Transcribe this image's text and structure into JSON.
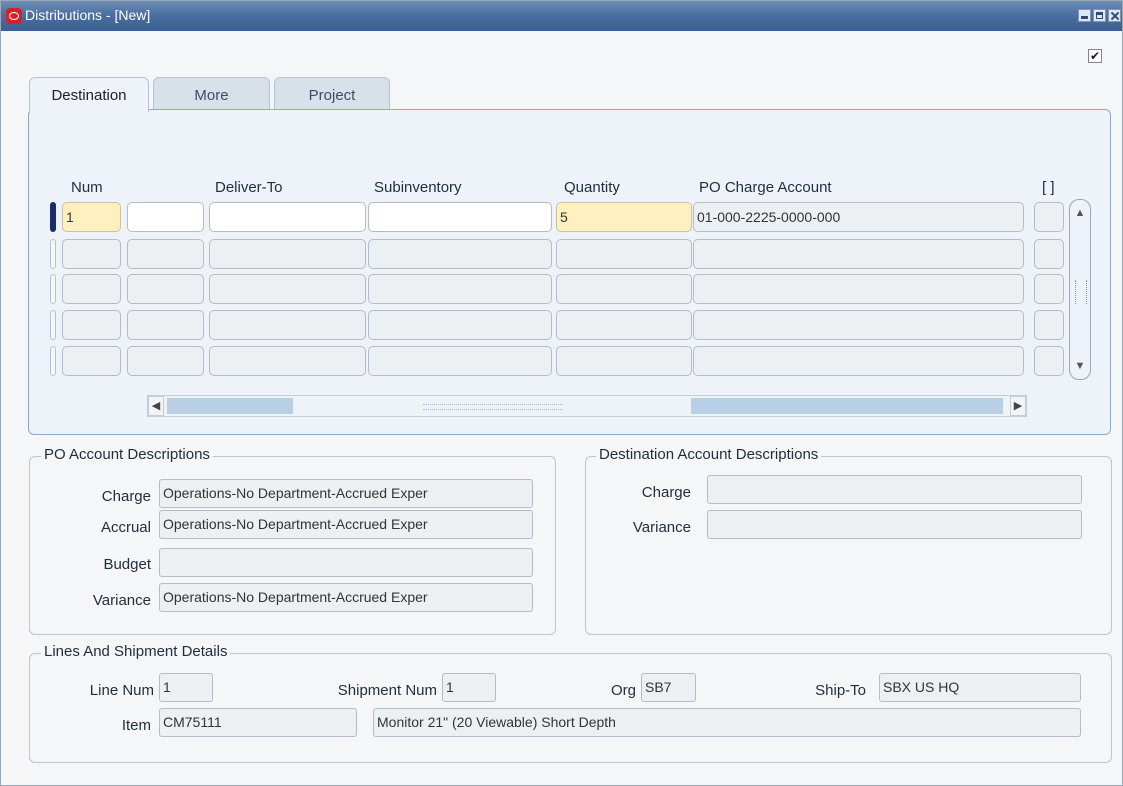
{
  "window": {
    "title": "Distributions - [New]",
    "check_mark": "✔"
  },
  "tabs": [
    {
      "label": "Destination",
      "active": true
    },
    {
      "label": "More",
      "active": false
    },
    {
      "label": "Project",
      "active": false
    }
  ],
  "table": {
    "headers": {
      "num": "Num",
      "deliver_to": "Deliver-To",
      "subinventory": "Subinventory",
      "quantity": "Quantity",
      "po_charge_account": "PO Charge Account",
      "extra": "[ ]"
    },
    "rows": [
      {
        "num": "1",
        "blank": "",
        "deliver_to": "",
        "subinventory": "",
        "quantity": "5",
        "po_charge_account": "01-000-2225-0000-000",
        "extra": ""
      },
      {
        "num": "",
        "blank": "",
        "deliver_to": "",
        "subinventory": "",
        "quantity": "",
        "po_charge_account": "",
        "extra": ""
      },
      {
        "num": "",
        "blank": "",
        "deliver_to": "",
        "subinventory": "",
        "quantity": "",
        "po_charge_account": "",
        "extra": ""
      },
      {
        "num": "",
        "blank": "",
        "deliver_to": "",
        "subinventory": "",
        "quantity": "",
        "po_charge_account": "",
        "extra": ""
      },
      {
        "num": "",
        "blank": "",
        "deliver_to": "",
        "subinventory": "",
        "quantity": "",
        "po_charge_account": "",
        "extra": ""
      }
    ]
  },
  "po_account_descriptions": {
    "legend": "PO Account Descriptions",
    "charge_label": "Charge",
    "charge": "Operations-No Department-Accrued Exper",
    "accrual_label": "Accrual",
    "accrual": "Operations-No Department-Accrued Exper",
    "budget_label": "Budget",
    "budget": "",
    "variance_label": "Variance",
    "variance": "Operations-No Department-Accrued Exper"
  },
  "destination_account_descriptions": {
    "legend": "Destination Account Descriptions",
    "charge_label": "Charge",
    "charge": "",
    "variance_label": "Variance",
    "variance": ""
  },
  "lines_shipment": {
    "legend": "Lines And Shipment Details",
    "line_num_label": "Line Num",
    "line_num": "1",
    "shipment_num_label": "Shipment Num",
    "shipment_num": "1",
    "org_label": "Org",
    "org": "SB7",
    "ship_to_label": "Ship-To",
    "ship_to": "SBX US HQ",
    "item_label": "Item",
    "item": "CM75111",
    "item_description": "Monitor 21\" (20 Viewable) Short Depth"
  },
  "colors": {
    "title_bar": "#4a6fa0",
    "current_row": "#1b2c6b",
    "required_field": "#fff1bf"
  }
}
